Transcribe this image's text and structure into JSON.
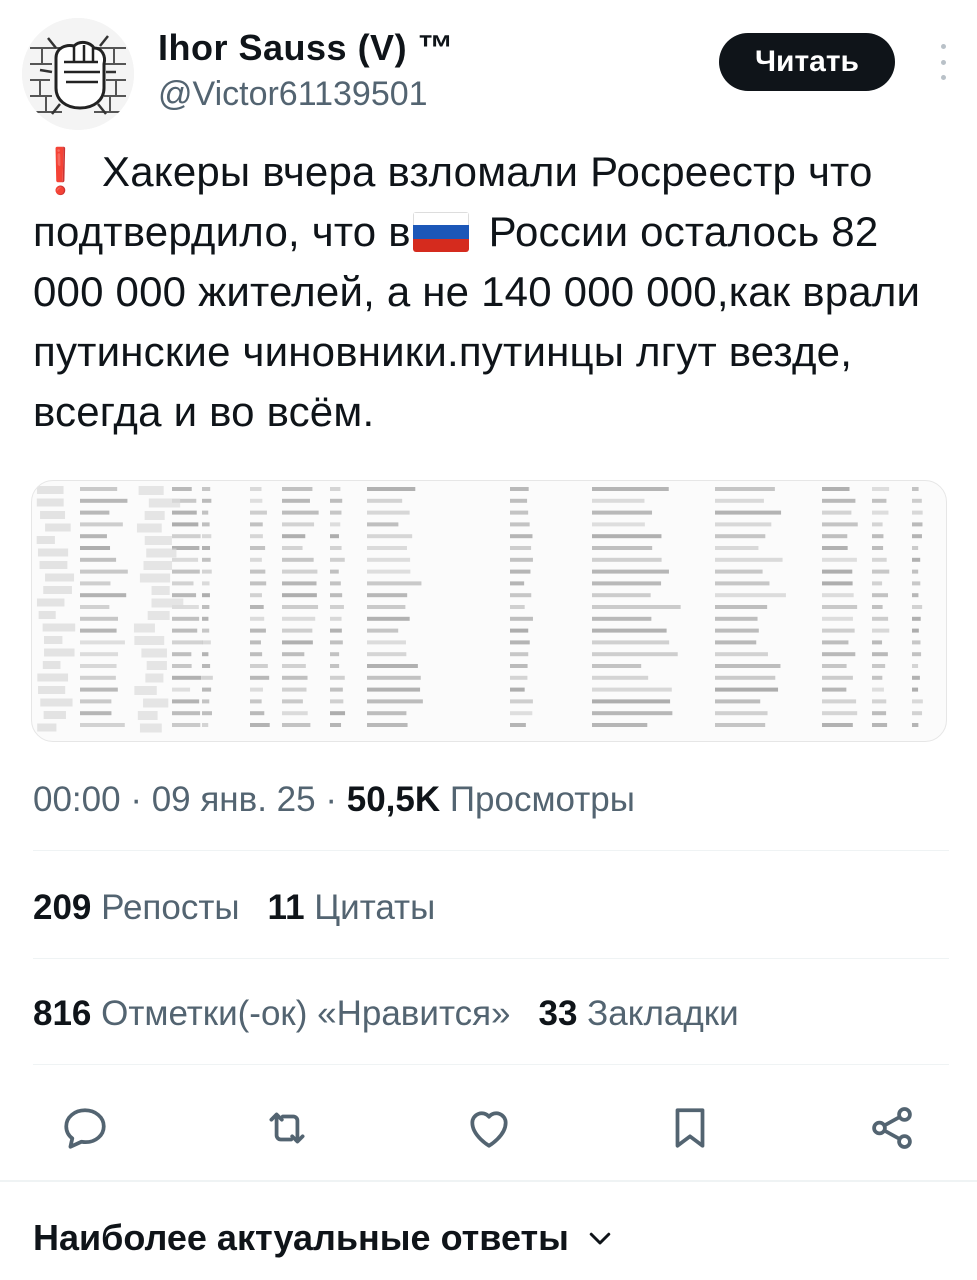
{
  "author": {
    "display_name": "Ihor Sauss (V) ™",
    "handle": "@Victor61139501",
    "avatar_icon": "fist-through-wall-avatar"
  },
  "follow_button_label": "Читать",
  "tweet": {
    "alert_icon": "❗",
    "text_part1": "Хакеры вчера взломали Росреестр что подтвердило, что в",
    "flag_icon": "russia-flag-icon",
    "text_part2": " России осталось 82 000 000 жителей, а не 140 000 000,как врали путинские чиновники.путинцы лгут везде, всегда и во всём."
  },
  "meta": {
    "time": "00:00",
    "sep1": " · ",
    "date": "09 янв. 25",
    "sep2": " · ",
    "views_count": "50,5K",
    "views_label": " Просмотры"
  },
  "stats": {
    "reposts_count": "209",
    "reposts_label": "Репосты",
    "quotes_count": "11",
    "quotes_label": "Цитаты",
    "likes_count": "816",
    "likes_label": "Отметки(-ок) «Нравится»",
    "bookmarks_count": "33",
    "bookmarks_label": "Закладки"
  },
  "actions": [
    "reply-icon",
    "repost-icon",
    "like-icon",
    "bookmark-icon",
    "share-icon"
  ],
  "replies_sort_label": "Наиболее актуальные ответы",
  "colors": {
    "text": "#0f1419",
    "secondary": "#536471",
    "alert": "#f4212e",
    "button_bg": "#0f1419",
    "icon": "#536471"
  }
}
